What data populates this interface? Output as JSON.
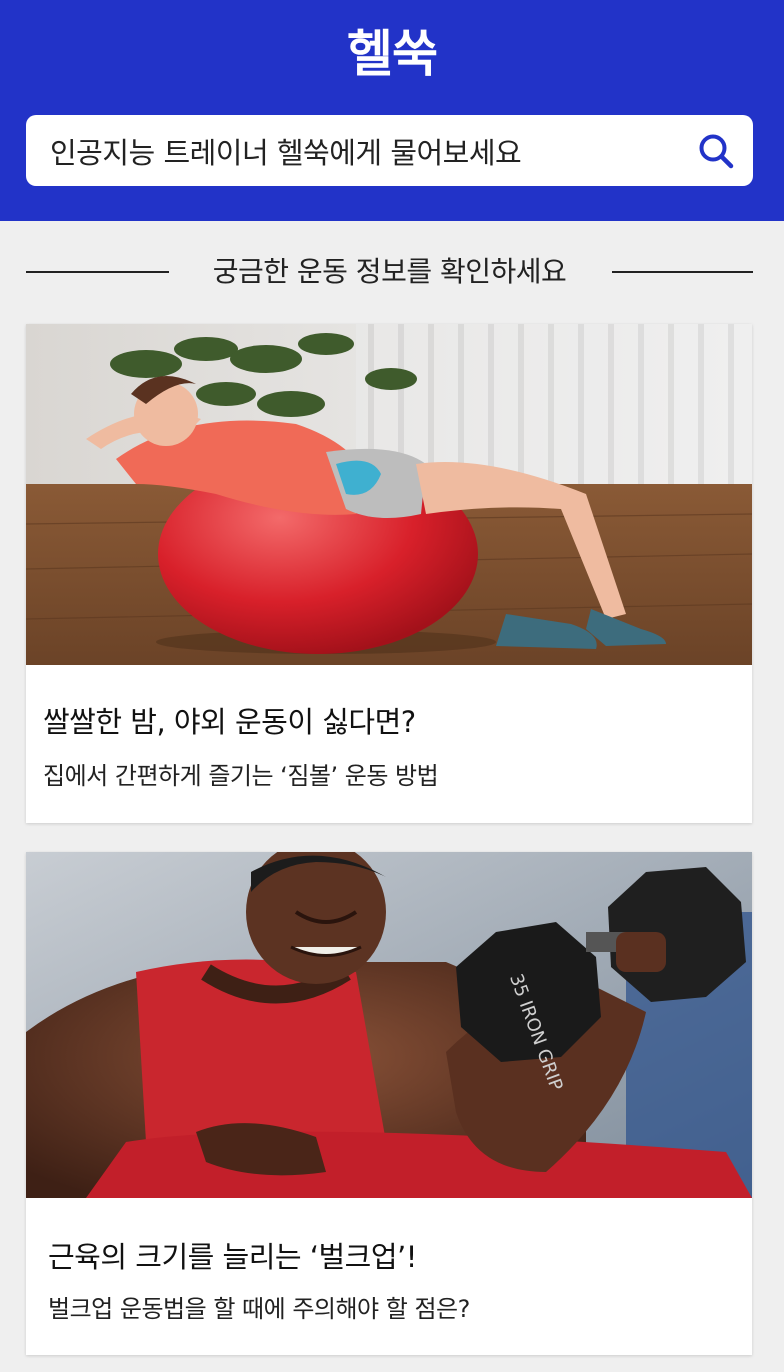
{
  "header": {
    "app_title": "헬쑥",
    "search": {
      "placeholder": "인공지능 트레이너 헬쑥에게 물어보세요",
      "icon": "search-icon"
    }
  },
  "section": {
    "title": "궁금한 운동 정보를 확인하세요"
  },
  "articles": [
    {
      "title": "쌀쌀한 밤, 야외 운동이 싫다면?",
      "subtitle": "집에서 간편하게 즐기는 ‘짐볼’ 운동 방법",
      "image": "gym-ball-exercise-photo"
    },
    {
      "title": "근육의 크기를 늘리는 ‘벌크업’!",
      "subtitle": "벌크업 운동법을 할 때에 주의해야 할 점은?",
      "image": "dumbbell-curl-photo"
    }
  ],
  "colors": {
    "header_bg": "#2233c8",
    "page_bg": "#efefef",
    "search_icon": "#2233c8"
  }
}
